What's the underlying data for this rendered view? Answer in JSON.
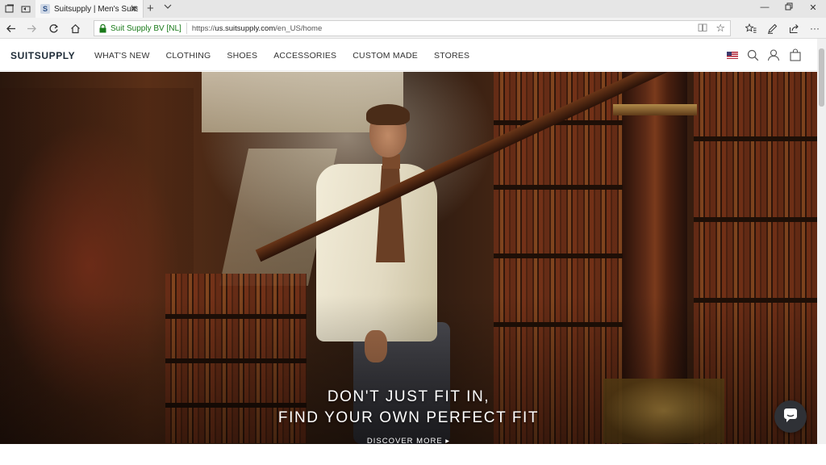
{
  "browser": {
    "tab_title": "Suitsupply | Men's Suits",
    "tab_favicon": "S",
    "site_identity": "Suit Supply BV [NL]",
    "url_prefix": "https://",
    "url_host": "us.suitsupply.com",
    "url_path": "/en_US/home",
    "icons": {
      "tab_actions": "tab-actions-icon",
      "set_aside": "set-aside-tabs-icon",
      "new_tab": "plus-icon",
      "tab_menu": "chevron-down-icon",
      "back": "back-arrow-icon",
      "forward": "forward-arrow-icon",
      "refresh": "refresh-icon",
      "home": "home-icon",
      "lock": "lock-icon",
      "reading_view": "reading-view-icon",
      "favorite": "star-icon",
      "favorites_hub": "favorites-hub-icon",
      "notes": "pen-icon",
      "share": "share-icon",
      "more": "more-icon"
    }
  },
  "site": {
    "logo": "SUITSUPPLY",
    "nav": [
      {
        "label": "WHAT'S NEW"
      },
      {
        "label": "CLOTHING"
      },
      {
        "label": "SHOES"
      },
      {
        "label": "ACCESSORIES"
      },
      {
        "label": "CUSTOM MADE"
      },
      {
        "label": "STORES"
      }
    ],
    "header_icons": {
      "flag": "us-flag-icon",
      "search": "search-icon",
      "account": "user-icon",
      "bag": "shopping-bag-icon"
    }
  },
  "hero": {
    "headline_line1": "DON'T JUST FIT IN,",
    "headline_line2": "FIND YOUR OWN PERFECT FIT",
    "cta": "DISCOVER MORE ▸"
  },
  "chat_icon": "chat-bubble-icon",
  "colors": {
    "logo": "#1d2a36",
    "secure_text": "#1a7a1a",
    "chat_button": "#2f3136"
  }
}
